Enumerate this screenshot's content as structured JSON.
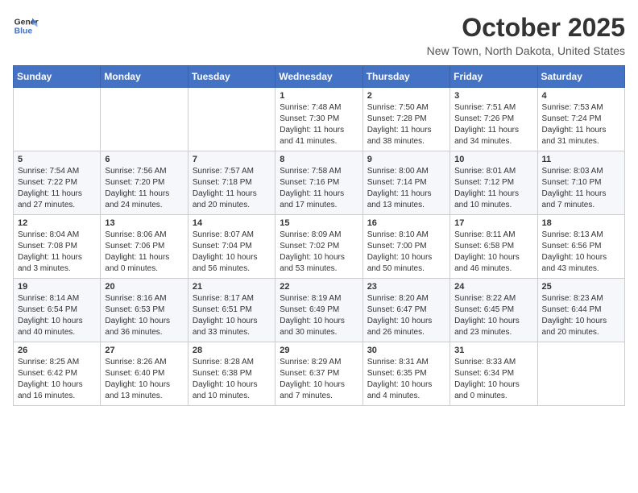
{
  "header": {
    "logo_line1": "General",
    "logo_line2": "Blue",
    "month": "October 2025",
    "location": "New Town, North Dakota, United States"
  },
  "weekdays": [
    "Sunday",
    "Monday",
    "Tuesday",
    "Wednesday",
    "Thursday",
    "Friday",
    "Saturday"
  ],
  "weeks": [
    [
      {
        "day": "",
        "sunrise": "",
        "sunset": "",
        "daylight": ""
      },
      {
        "day": "",
        "sunrise": "",
        "sunset": "",
        "daylight": ""
      },
      {
        "day": "",
        "sunrise": "",
        "sunset": "",
        "daylight": ""
      },
      {
        "day": "1",
        "sunrise": "Sunrise: 7:48 AM",
        "sunset": "Sunset: 7:30 PM",
        "daylight": "Daylight: 11 hours and 41 minutes."
      },
      {
        "day": "2",
        "sunrise": "Sunrise: 7:50 AM",
        "sunset": "Sunset: 7:28 PM",
        "daylight": "Daylight: 11 hours and 38 minutes."
      },
      {
        "day": "3",
        "sunrise": "Sunrise: 7:51 AM",
        "sunset": "Sunset: 7:26 PM",
        "daylight": "Daylight: 11 hours and 34 minutes."
      },
      {
        "day": "4",
        "sunrise": "Sunrise: 7:53 AM",
        "sunset": "Sunset: 7:24 PM",
        "daylight": "Daylight: 11 hours and 31 minutes."
      }
    ],
    [
      {
        "day": "5",
        "sunrise": "Sunrise: 7:54 AM",
        "sunset": "Sunset: 7:22 PM",
        "daylight": "Daylight: 11 hours and 27 minutes."
      },
      {
        "day": "6",
        "sunrise": "Sunrise: 7:56 AM",
        "sunset": "Sunset: 7:20 PM",
        "daylight": "Daylight: 11 hours and 24 minutes."
      },
      {
        "day": "7",
        "sunrise": "Sunrise: 7:57 AM",
        "sunset": "Sunset: 7:18 PM",
        "daylight": "Daylight: 11 hours and 20 minutes."
      },
      {
        "day": "8",
        "sunrise": "Sunrise: 7:58 AM",
        "sunset": "Sunset: 7:16 PM",
        "daylight": "Daylight: 11 hours and 17 minutes."
      },
      {
        "day": "9",
        "sunrise": "Sunrise: 8:00 AM",
        "sunset": "Sunset: 7:14 PM",
        "daylight": "Daylight: 11 hours and 13 minutes."
      },
      {
        "day": "10",
        "sunrise": "Sunrise: 8:01 AM",
        "sunset": "Sunset: 7:12 PM",
        "daylight": "Daylight: 11 hours and 10 minutes."
      },
      {
        "day": "11",
        "sunrise": "Sunrise: 8:03 AM",
        "sunset": "Sunset: 7:10 PM",
        "daylight": "Daylight: 11 hours and 7 minutes."
      }
    ],
    [
      {
        "day": "12",
        "sunrise": "Sunrise: 8:04 AM",
        "sunset": "Sunset: 7:08 PM",
        "daylight": "Daylight: 11 hours and 3 minutes."
      },
      {
        "day": "13",
        "sunrise": "Sunrise: 8:06 AM",
        "sunset": "Sunset: 7:06 PM",
        "daylight": "Daylight: 11 hours and 0 minutes."
      },
      {
        "day": "14",
        "sunrise": "Sunrise: 8:07 AM",
        "sunset": "Sunset: 7:04 PM",
        "daylight": "Daylight: 10 hours and 56 minutes."
      },
      {
        "day": "15",
        "sunrise": "Sunrise: 8:09 AM",
        "sunset": "Sunset: 7:02 PM",
        "daylight": "Daylight: 10 hours and 53 minutes."
      },
      {
        "day": "16",
        "sunrise": "Sunrise: 8:10 AM",
        "sunset": "Sunset: 7:00 PM",
        "daylight": "Daylight: 10 hours and 50 minutes."
      },
      {
        "day": "17",
        "sunrise": "Sunrise: 8:11 AM",
        "sunset": "Sunset: 6:58 PM",
        "daylight": "Daylight: 10 hours and 46 minutes."
      },
      {
        "day": "18",
        "sunrise": "Sunrise: 8:13 AM",
        "sunset": "Sunset: 6:56 PM",
        "daylight": "Daylight: 10 hours and 43 minutes."
      }
    ],
    [
      {
        "day": "19",
        "sunrise": "Sunrise: 8:14 AM",
        "sunset": "Sunset: 6:54 PM",
        "daylight": "Daylight: 10 hours and 40 minutes."
      },
      {
        "day": "20",
        "sunrise": "Sunrise: 8:16 AM",
        "sunset": "Sunset: 6:53 PM",
        "daylight": "Daylight: 10 hours and 36 minutes."
      },
      {
        "day": "21",
        "sunrise": "Sunrise: 8:17 AM",
        "sunset": "Sunset: 6:51 PM",
        "daylight": "Daylight: 10 hours and 33 minutes."
      },
      {
        "day": "22",
        "sunrise": "Sunrise: 8:19 AM",
        "sunset": "Sunset: 6:49 PM",
        "daylight": "Daylight: 10 hours and 30 minutes."
      },
      {
        "day": "23",
        "sunrise": "Sunrise: 8:20 AM",
        "sunset": "Sunset: 6:47 PM",
        "daylight": "Daylight: 10 hours and 26 minutes."
      },
      {
        "day": "24",
        "sunrise": "Sunrise: 8:22 AM",
        "sunset": "Sunset: 6:45 PM",
        "daylight": "Daylight: 10 hours and 23 minutes."
      },
      {
        "day": "25",
        "sunrise": "Sunrise: 8:23 AM",
        "sunset": "Sunset: 6:44 PM",
        "daylight": "Daylight: 10 hours and 20 minutes."
      }
    ],
    [
      {
        "day": "26",
        "sunrise": "Sunrise: 8:25 AM",
        "sunset": "Sunset: 6:42 PM",
        "daylight": "Daylight: 10 hours and 16 minutes."
      },
      {
        "day": "27",
        "sunrise": "Sunrise: 8:26 AM",
        "sunset": "Sunset: 6:40 PM",
        "daylight": "Daylight: 10 hours and 13 minutes."
      },
      {
        "day": "28",
        "sunrise": "Sunrise: 8:28 AM",
        "sunset": "Sunset: 6:38 PM",
        "daylight": "Daylight: 10 hours and 10 minutes."
      },
      {
        "day": "29",
        "sunrise": "Sunrise: 8:29 AM",
        "sunset": "Sunset: 6:37 PM",
        "daylight": "Daylight: 10 hours and 7 minutes."
      },
      {
        "day": "30",
        "sunrise": "Sunrise: 8:31 AM",
        "sunset": "Sunset: 6:35 PM",
        "daylight": "Daylight: 10 hours and 4 minutes."
      },
      {
        "day": "31",
        "sunrise": "Sunrise: 8:33 AM",
        "sunset": "Sunset: 6:34 PM",
        "daylight": "Daylight: 10 hours and 0 minutes."
      },
      {
        "day": "",
        "sunrise": "",
        "sunset": "",
        "daylight": ""
      }
    ]
  ]
}
